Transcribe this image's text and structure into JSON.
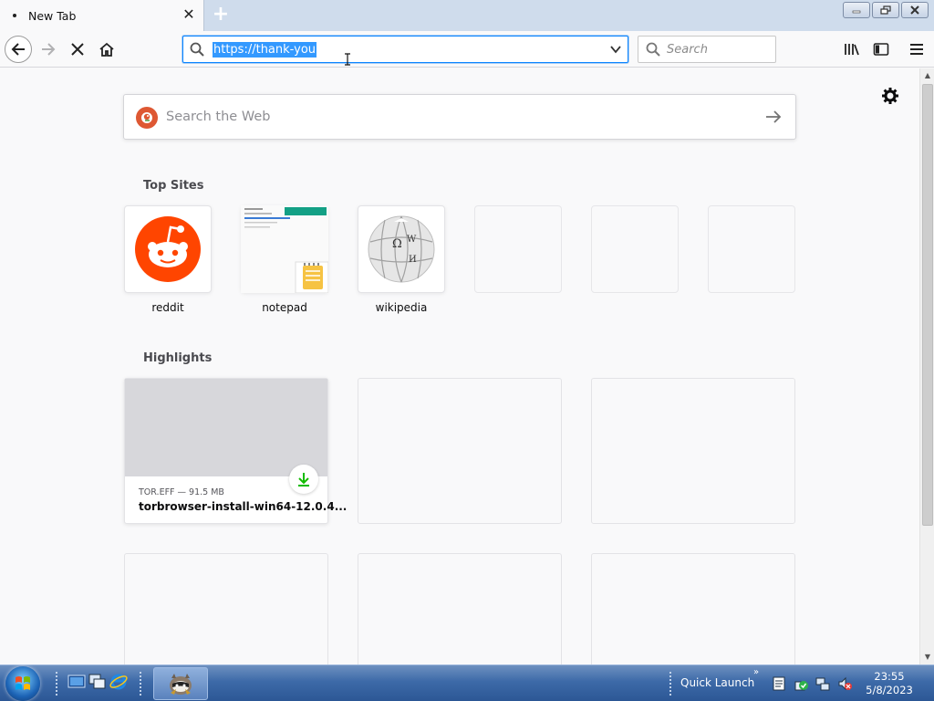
{
  "window": {
    "tab_title": "New Tab",
    "new_tab_symbol": "+"
  },
  "navbar": {
    "url": "https://thank-you",
    "search_placeholder": "Search"
  },
  "newtab": {
    "web_search_placeholder": "Search the Web",
    "top_sites_title": "Top Sites",
    "top_sites": [
      {
        "label": "reddit",
        "icon": "reddit-icon"
      },
      {
        "label": "notepad",
        "icon": "notepad-icon"
      },
      {
        "label": "wikipedia",
        "icon": "wikipedia-icon"
      },
      {
        "label": "",
        "icon": ""
      },
      {
        "label": "",
        "icon": ""
      },
      {
        "label": "",
        "icon": ""
      }
    ],
    "highlights_title": "Highlights",
    "highlights": [
      {
        "source": "TOR.EFF — 91.5 MB",
        "title": "torbrowser-install-win64-12.0.4..."
      }
    ]
  },
  "taskbar": {
    "quick_launch_label": "Quick Launch",
    "chevron": "»",
    "time": "23:55",
    "date": "5/8/2023"
  },
  "colors": {
    "accent": "#0a84ff",
    "reddit": "#ff4500",
    "download_green": "#12bc00"
  }
}
